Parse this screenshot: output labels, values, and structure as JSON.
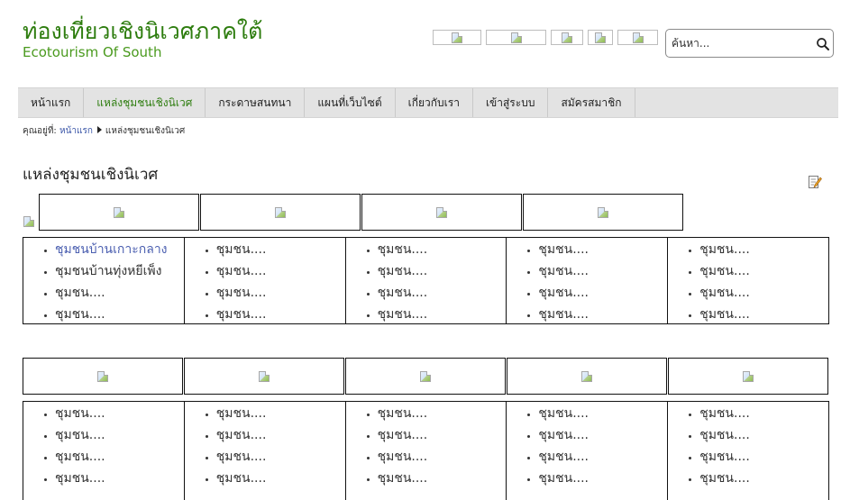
{
  "header": {
    "title": "ท่องเที่ยวเชิงนิเวศภาคใต้",
    "subtitle": "Ecotourism Of South"
  },
  "banners": [
    "",
    "",
    "",
    "",
    ""
  ],
  "search": {
    "placeholder": "ค้นหา..."
  },
  "nav": {
    "items": [
      {
        "label": "หน้าแรก"
      },
      {
        "label": "แหล่งชุมชนเชิงนิเวศ",
        "active": true
      },
      {
        "label": "กระดาษสนทนา"
      },
      {
        "label": "แผนที่เว็บไซต์"
      },
      {
        "label": "เกี่ยวกับเรา"
      },
      {
        "label": "เข้าสู่ระบบ"
      },
      {
        "label": "สมัครสมาชิก"
      }
    ]
  },
  "breadcrumb": {
    "prefix": "คุณอยู่ที่:",
    "home": "หน้าแรก",
    "current": "แหล่งชุมชนเชิงนิเวศ"
  },
  "page": {
    "heading": "แหล่งชุมชนเชิงนิเวศ"
  },
  "section1": {
    "columns": [
      [
        "ชุมชนบ้านเกาะกลาง",
        "ชุมชนบ้านทุ่งหยีเพ็ง",
        "ชุมชน....",
        "ชุมชน...."
      ],
      [
        "ชุมชน....",
        "ชุมชน....",
        "ชุมชน....",
        "ชุมชน...."
      ],
      [
        "ชุมชน....",
        "ชุมชน....",
        "ชุมชน....",
        "ชุมชน...."
      ],
      [
        "ชุมชน....",
        "ชุมชน....",
        "ชุมชน....",
        "ชุมชน...."
      ],
      [
        "ชุมชน....",
        "ชุมชน....",
        "ชุมชน....",
        "ชุมชน...."
      ]
    ]
  },
  "section2": {
    "columns": [
      [
        "ชุมชน....",
        "ชุมชน....",
        "ชุมชน....",
        "ชุมชน...."
      ],
      [
        "ชุมชน....",
        "ชุมชน....",
        "ชุมชน....",
        "ชุมชน...."
      ],
      [
        "ชุมชน....",
        "ชุมชน....",
        "ชุมชน....",
        "ชุมชน...."
      ],
      [
        "ชุมชน....",
        "ชุมชน....",
        "ชุมชน....",
        "ชุมชน...."
      ],
      [
        "ชุมชน....",
        "ชุมชน....",
        "ชุมชน....",
        "ชุมชน...."
      ]
    ]
  },
  "colors": {
    "title_green": "#2e7d0f",
    "link_blue": "#3b56a8",
    "nav_bg": "#e3e3e3"
  }
}
